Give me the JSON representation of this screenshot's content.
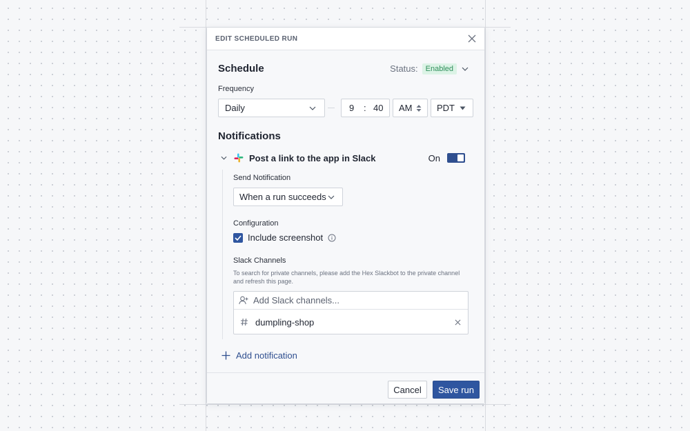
{
  "dialog": {
    "title": "EDIT SCHEDULED RUN",
    "close_icon": "close-icon"
  },
  "schedule": {
    "heading": "Schedule",
    "status_label": "Status:",
    "status_value": "Enabled",
    "frequency_label": "Frequency",
    "frequency_value": "Daily",
    "hour": "9",
    "time_separator": ":",
    "minute": "40",
    "meridiem": "AM",
    "timezone": "PDT"
  },
  "notifications": {
    "heading": "Notifications",
    "slack": {
      "icon": "slack-icon",
      "title": "Post a link to the app in Slack",
      "toggle_label": "On",
      "enabled": true,
      "send_label": "Send Notification",
      "send_value": "When a run succeeds",
      "config_label": "Configuration",
      "include_screenshot_label": "Include screenshot",
      "include_screenshot_checked": true,
      "channels_label": "Slack Channels",
      "channels_help": "To search for private channels, please add the Hex Slackbot to the private channel and refresh this page.",
      "channels_placeholder": "Add Slack channels...",
      "channels": [
        "dumpling-shop"
      ]
    },
    "add_label": "Add notification"
  },
  "footer": {
    "cancel_label": "Cancel",
    "save_label": "Save run"
  },
  "colors": {
    "primary": "#2f56a0",
    "badge_bg": "#dcf3e6",
    "badge_text": "#2f8f5b"
  }
}
